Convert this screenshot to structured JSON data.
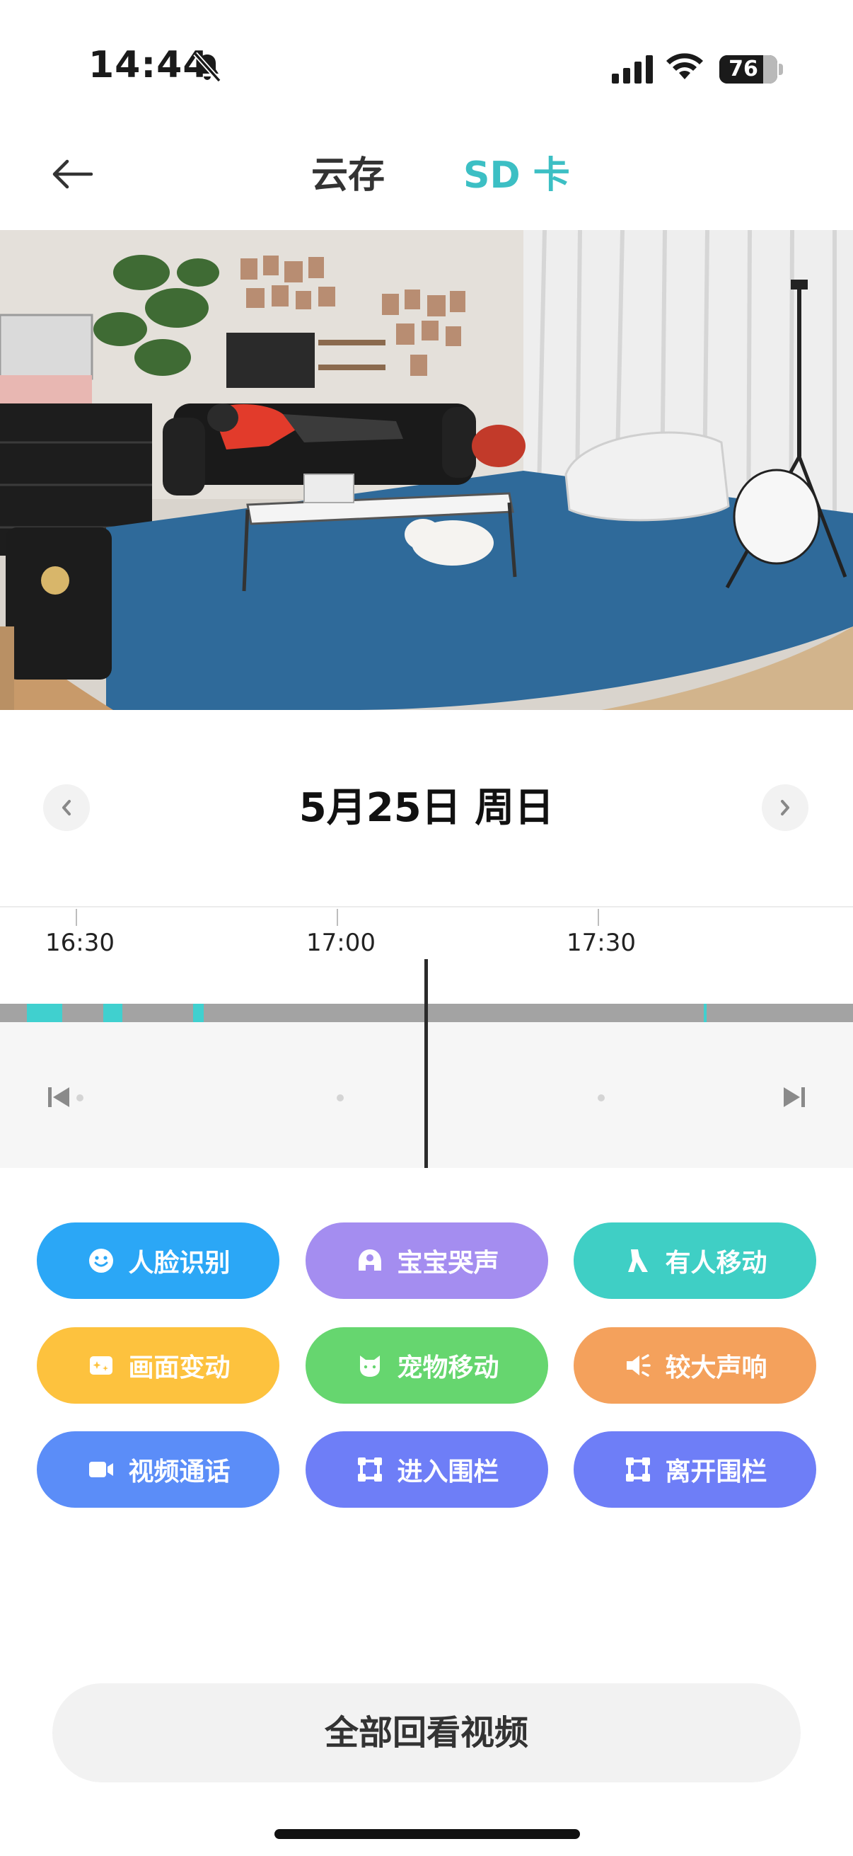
{
  "status_bar": {
    "time": "14:44",
    "battery": "76",
    "battery_level": 0.76
  },
  "nav": {
    "tab_cloud": "云存",
    "tab_sd": "SD 卡",
    "active_tab": "SD 卡",
    "accent_color": "#3cbfc4"
  },
  "date": {
    "label": "5月25日 周日"
  },
  "timeline": {
    "ticks": [
      "16:30",
      "17:00",
      "17:30"
    ],
    "record_color": "#a3a3a3",
    "event_color": "#40d0cf"
  },
  "chips": [
    {
      "label": "人脸识别",
      "icon": "face-icon",
      "color": "#2ba7f6"
    },
    {
      "label": "宝宝哭声",
      "icon": "baby-icon",
      "color": "#a48df0"
    },
    {
      "label": "有人移动",
      "icon": "person-moving-icon",
      "color": "#3fcfc5"
    },
    {
      "label": "画面变动",
      "icon": "image-change-icon",
      "color": "#fdc23e"
    },
    {
      "label": "宠物移动",
      "icon": "pet-icon",
      "color": "#66d66f"
    },
    {
      "label": "较大声响",
      "icon": "loud-sound-icon",
      "color": "#f4a15c"
    },
    {
      "label": "视频通话",
      "icon": "video-call-icon",
      "color": "#5b8df8"
    },
    {
      "label": "进入围栏",
      "icon": "fence-enter-icon",
      "color": "#6e7ef7"
    },
    {
      "label": "离开围栏",
      "icon": "fence-leave-icon",
      "color": "#6e7ef7"
    }
  ],
  "replay_all": "全部回看视频"
}
